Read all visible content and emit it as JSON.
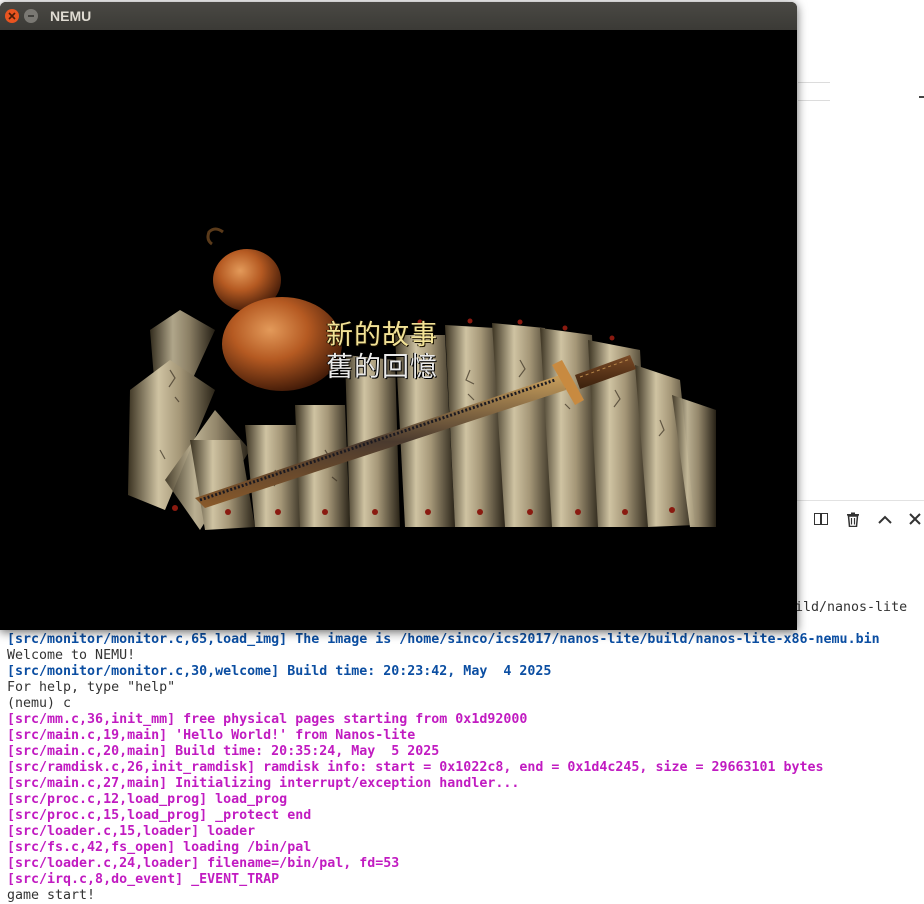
{
  "window": {
    "title": "NEMU"
  },
  "game": {
    "caption_line1": "新的故事",
    "caption_line2": "舊的回憶"
  },
  "panel": {
    "icons": [
      "split-terminal-icon",
      "trash-icon",
      "chevron-up-icon",
      "close-icon"
    ]
  },
  "terminal": {
    "top_right_fragment": "ild/nanos-lite",
    "lines": [
      {
        "text": "[src/monitor/monitor.c,65,load_img] The image is /home/sinco/ics2017/nanos-lite/build/nanos-lite-x86-nemu.bin",
        "style": "blue"
      },
      {
        "text": "Welcome to NEMU!",
        "style": "plain"
      },
      {
        "text": "[src/monitor/monitor.c,30,welcome] Build time: 20:23:42, May  4 2025",
        "style": "blue"
      },
      {
        "text": "For help, type \"help\"",
        "style": "plain"
      },
      {
        "text": "(nemu) c",
        "style": "plain"
      },
      {
        "text": "[src/mm.c,36,init_mm] free physical pages starting from 0x1d92000",
        "style": "magenta"
      },
      {
        "text": "[src/main.c,19,main] 'Hello World!' from Nanos-lite",
        "style": "magenta"
      },
      {
        "text": "[src/main.c,20,main] Build time: 20:35:24, May  5 2025",
        "style": "magenta"
      },
      {
        "text": "[src/ramdisk.c,26,init_ramdisk] ramdisk info: start = 0x1022c8, end = 0x1d4c245, size = 29663101 bytes",
        "style": "magenta"
      },
      {
        "text": "[src/main.c,27,main] Initializing interrupt/exception handler...",
        "style": "magenta"
      },
      {
        "text": "[src/proc.c,12,load_prog] load_prog",
        "style": "magenta"
      },
      {
        "text": "[src/proc.c,15,load_prog] _protect end",
        "style": "magenta"
      },
      {
        "text": "[src/loader.c,15,loader] loader",
        "style": "magenta"
      },
      {
        "text": "[src/fs.c,42,fs_open] loading /bin/pal",
        "style": "magenta"
      },
      {
        "text": "[src/loader.c,24,loader] filename=/bin/pal, fd=53",
        "style": "magenta"
      },
      {
        "text": "[src/irq.c,8,do_event] _EVENT_TRAP",
        "style": "magenta"
      },
      {
        "text": "game start!",
        "style": "plain"
      }
    ]
  },
  "colors": {
    "blue": "#0b4ea2",
    "magenta": "#c11bc1",
    "plain": "#333333",
    "titlebar": "#3d3c38",
    "close_button": "#e95420"
  }
}
